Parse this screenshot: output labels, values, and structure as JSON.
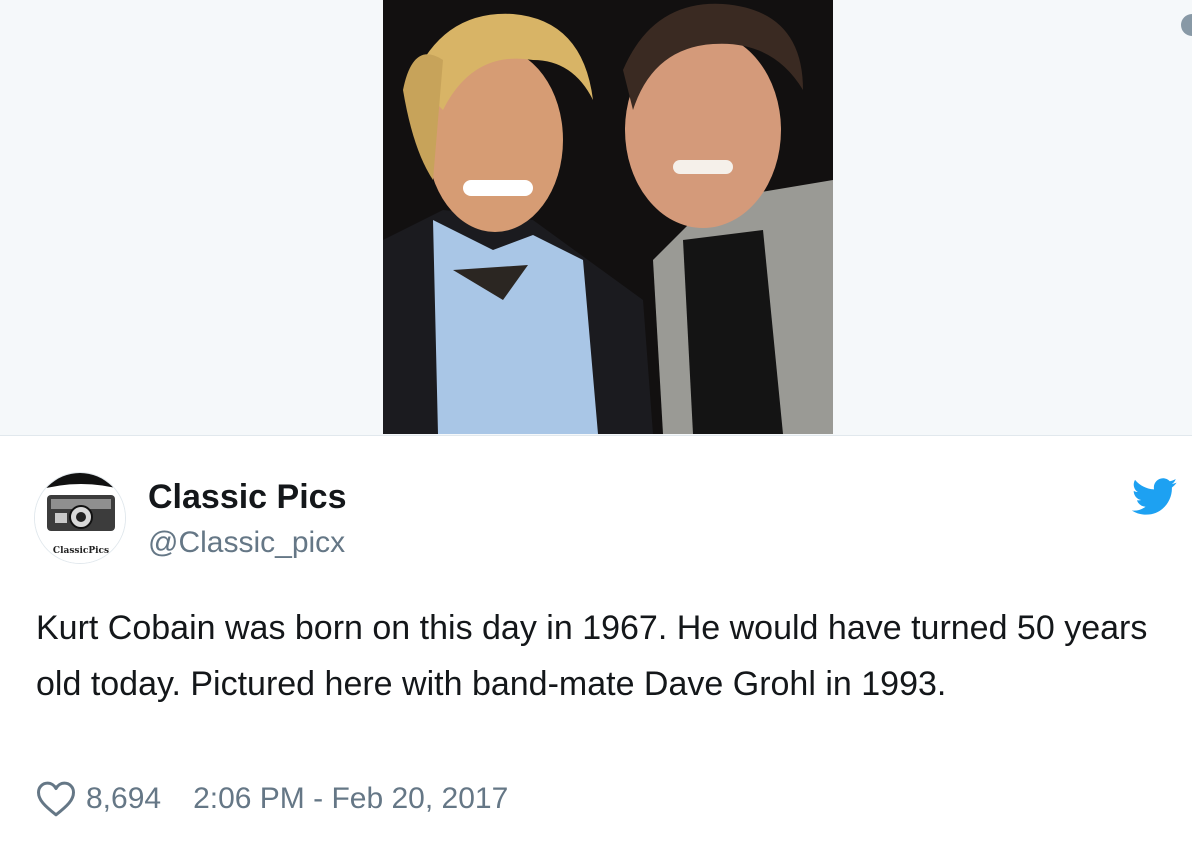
{
  "tweet": {
    "display_name": "Classic Pics",
    "handle": "@Classic_picx",
    "avatar_label": "ClassicPics",
    "text": "Kurt Cobain was born on this day in 1967. He would have turned 50 years old today. Pictured here with band-mate Dave Grohl in 1993.",
    "likes": "8,694",
    "timestamp": "2:06 PM - Feb 20, 2017"
  },
  "icons": {
    "like": "heart-icon",
    "brand": "twitter-bird-icon"
  },
  "colors": {
    "brand": "#1da1f2",
    "secondary_text": "#657786",
    "primary_text": "#14171a"
  }
}
